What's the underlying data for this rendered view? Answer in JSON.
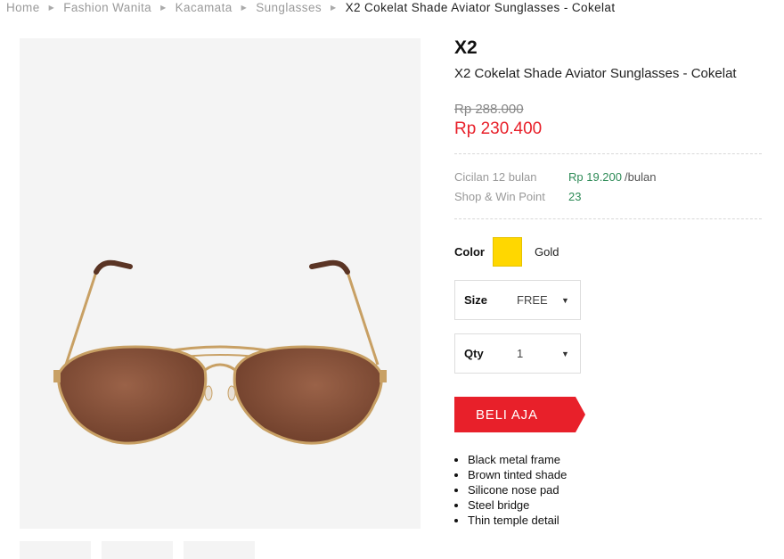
{
  "breadcrumb": {
    "items": [
      "Home",
      "Fashion Wanita",
      "Kacamata",
      "Sunglasses"
    ],
    "current": "X2 Cokelat Shade Aviator Sunglasses - Cokelat"
  },
  "product": {
    "brand": "X2",
    "name": "X2 Cokelat Shade Aviator Sunglasses - Cokelat",
    "old_price": "Rp 288.000",
    "new_price": "Rp 230.400"
  },
  "installment": {
    "label": "Cicilan 12 bulan",
    "value": "Rp 19.200",
    "suffix": "/bulan"
  },
  "points": {
    "label": "Shop & Win Point",
    "value": "23"
  },
  "color_option": {
    "label": "Color",
    "value": "Gold",
    "swatch": "#ffd700"
  },
  "size_option": {
    "label": "Size",
    "value": "FREE"
  },
  "qty_option": {
    "label": "Qty",
    "value": "1"
  },
  "buy_button": {
    "label": "BELI AJA",
    "color": "#e8202a"
  },
  "features": [
    "Black metal frame",
    "Brown tinted shade",
    "Silicone nose pad",
    "Steel bridge",
    "Thin temple detail"
  ],
  "colors": {
    "accent": "#e8202a",
    "installment": "#2e8b57"
  }
}
